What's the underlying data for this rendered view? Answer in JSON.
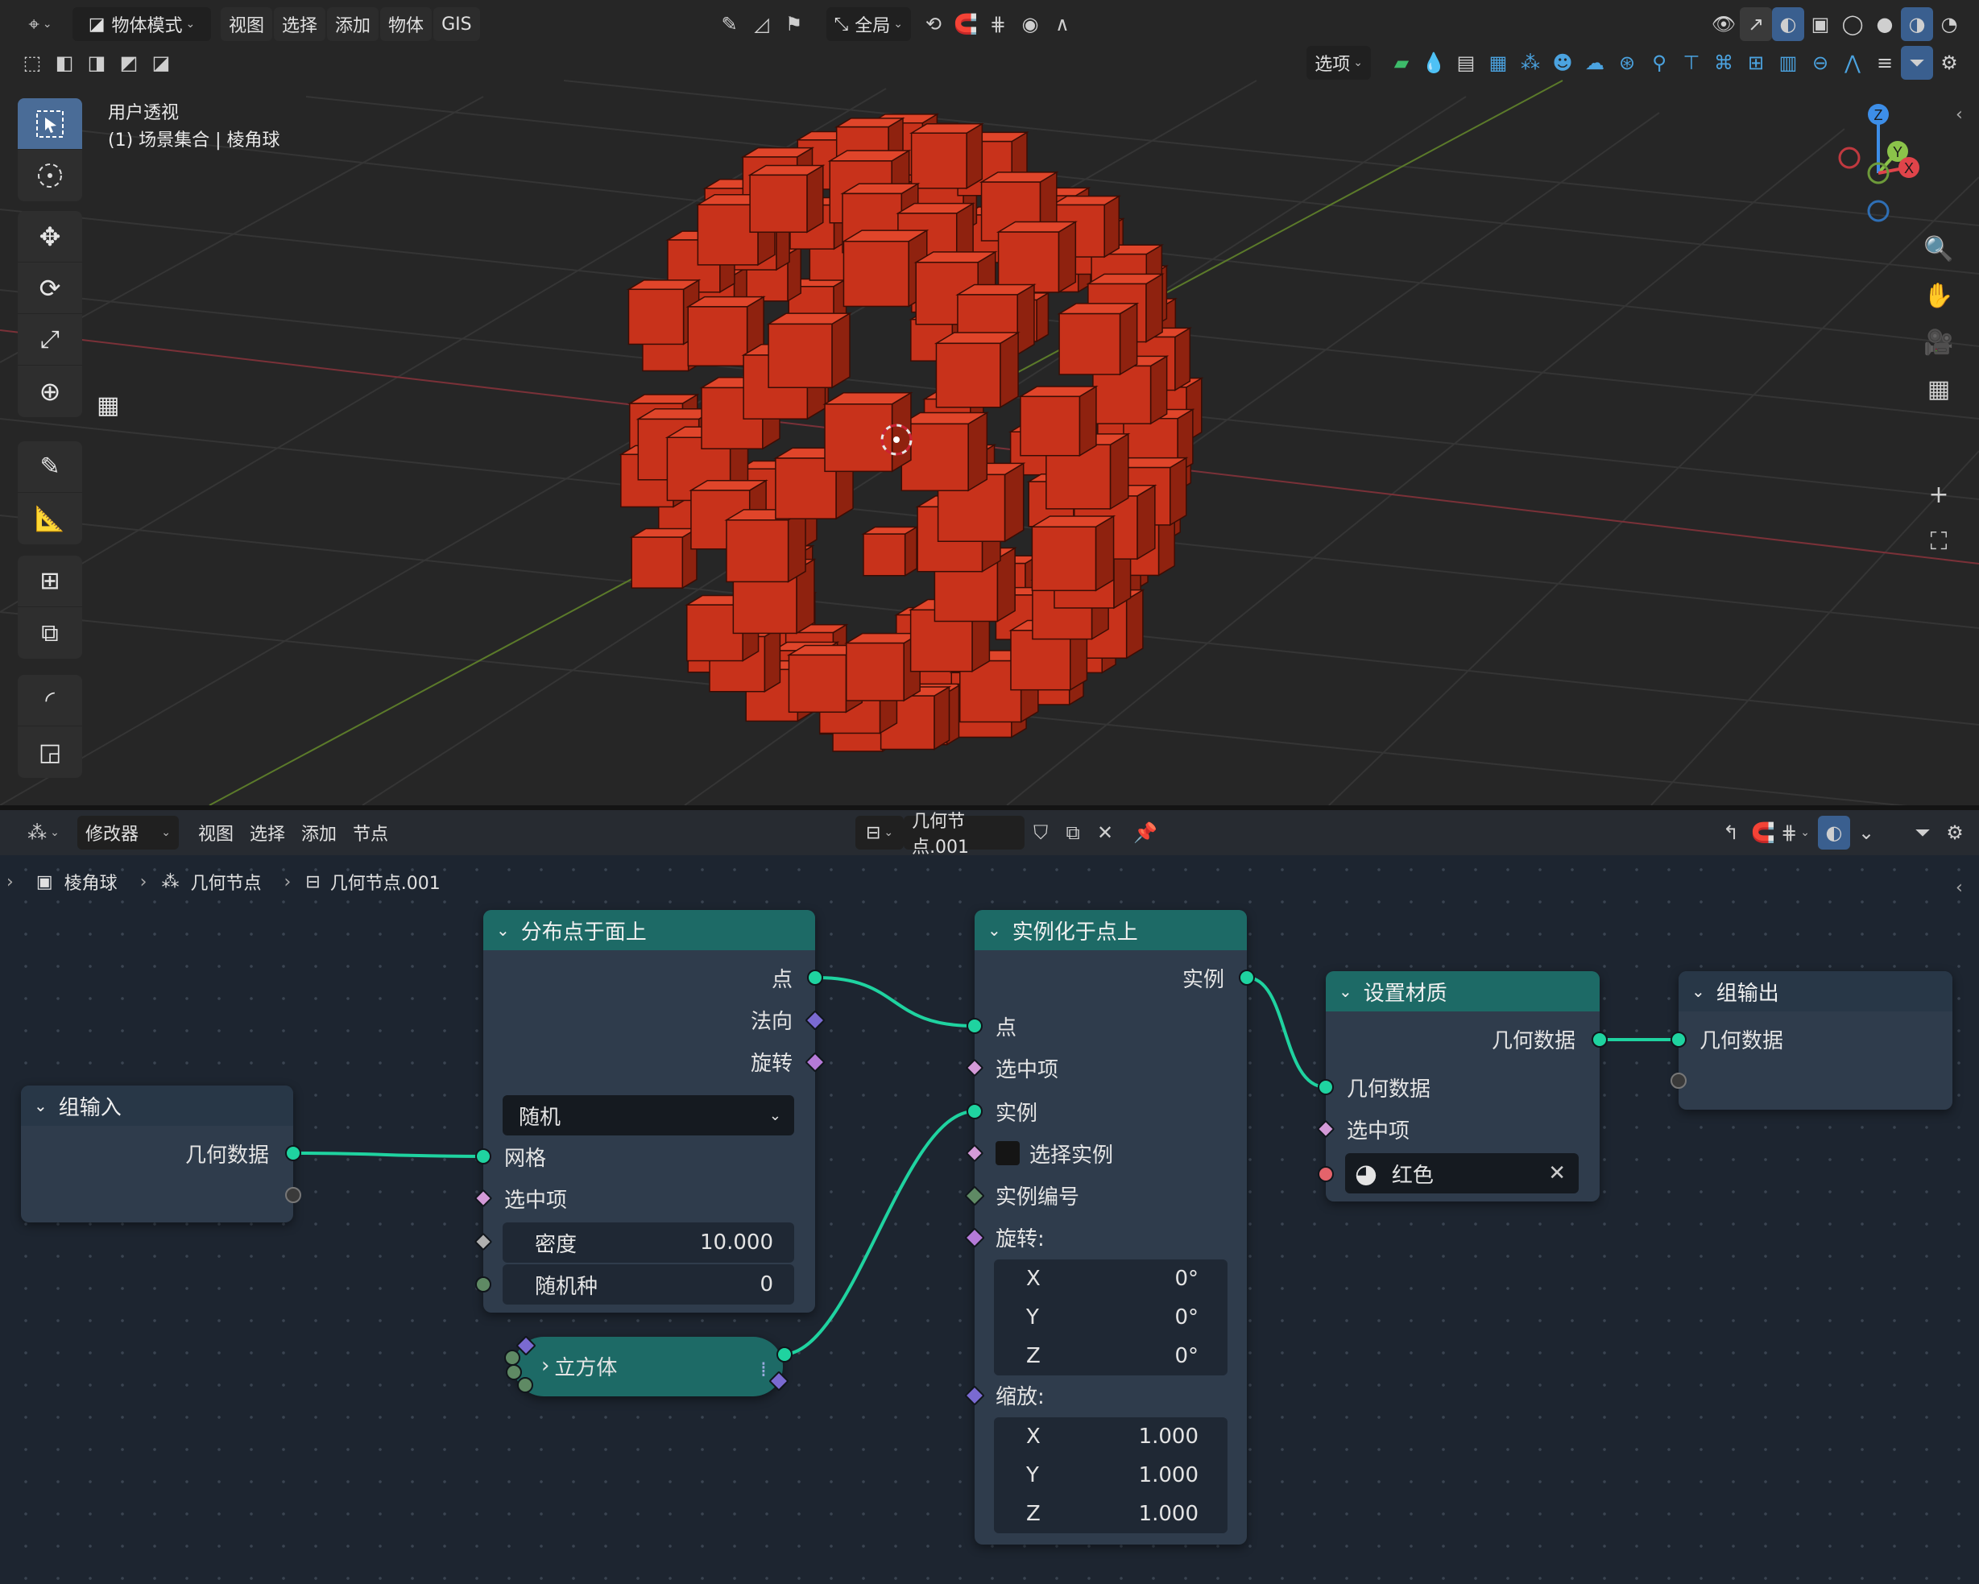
{
  "topbar": {
    "mode_label": "物体模式",
    "menus": [
      "视图",
      "选择",
      "添加",
      "物体",
      "GIS"
    ],
    "transform_orientation": "全局",
    "options_label": "选项"
  },
  "viewport": {
    "overlay_line1": "用户透视",
    "overlay_line2": "(1) 场景集合 | 棱角球",
    "object_color": "#c8321b",
    "gizmo": {
      "z": "Z",
      "y": "Y",
      "x": "X"
    }
  },
  "node_editor": {
    "header": {
      "editor_label": "修改器",
      "menus": [
        "视图",
        "选择",
        "添加",
        "节点"
      ],
      "tree_name": "几何节点.001"
    },
    "breadcrumb": {
      "object": "棱角球",
      "modifier": "几何节点",
      "tree": "几何节点.001"
    },
    "nodes": {
      "group_input": {
        "title": "组输入",
        "out_geometry": "几何数据"
      },
      "distribute": {
        "title": "分布点于面上",
        "out_points": "点",
        "out_normal": "法向",
        "out_rotation": "旋转",
        "mode": "随机",
        "in_mesh": "网格",
        "in_selection": "选中项",
        "density_label": "密度",
        "density_value": "10.000",
        "seed_label": "随机种",
        "seed_value": "0"
      },
      "cube": {
        "title": "立方体"
      },
      "instance": {
        "title": "实例化于点上",
        "out_instances": "实例",
        "in_points": "点",
        "in_selection": "选中项",
        "in_instance": "实例",
        "pick_instance": "选择实例",
        "instance_index": "实例编号",
        "rotation_label": "旋转:",
        "rot_x": "X",
        "rot_x_val": "0°",
        "rot_y": "Y",
        "rot_y_val": "0°",
        "rot_z": "Z",
        "rot_z_val": "0°",
        "scale_label": "缩放:",
        "sc_x": "X",
        "sc_x_val": "1.000",
        "sc_y": "Y",
        "sc_y_val": "1.000",
        "sc_z": "Z",
        "sc_z_val": "1.000"
      },
      "set_material": {
        "title": "设置材质",
        "out_geometry": "几何数据",
        "in_geometry": "几何数据",
        "in_selection": "选中项",
        "material": "红色"
      },
      "group_output": {
        "title": "组输出",
        "in_geometry": "几何数据"
      }
    },
    "wire_color": "#1fd3a0"
  }
}
